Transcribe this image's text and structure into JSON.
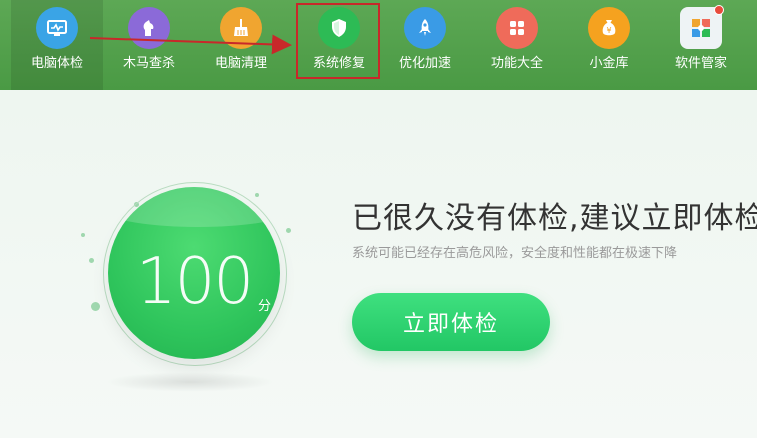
{
  "nav": {
    "items": [
      {
        "label": "电脑体检",
        "icon": "monitor-icon",
        "color": "#3aa4e6"
      },
      {
        "label": "木马查杀",
        "icon": "horse-icon",
        "color": "#8b6ad8"
      },
      {
        "label": "电脑清理",
        "icon": "broom-icon",
        "color": "#f0a530"
      },
      {
        "label": "系统修复",
        "icon": "shield-icon",
        "color": "#2dbb55"
      },
      {
        "label": "优化加速",
        "icon": "rocket-icon",
        "color": "#3a9be6"
      },
      {
        "label": "功能大全",
        "icon": "grid-icon",
        "color": "#ef6b5a"
      },
      {
        "label": "小金库",
        "icon": "money-bag-icon",
        "color": "#f5a21f"
      },
      {
        "label": "软件管家",
        "icon": "software-icon",
        "color": "#eef3f5"
      }
    ],
    "active_index": 0,
    "highlighted_index": 3
  },
  "annotation": {
    "arrow_color": "#c8282a",
    "box_color": "#c8282a"
  },
  "gauge": {
    "score": "100",
    "unit": "分"
  },
  "headline": "已很久没有体检,建议立即体检",
  "subline": "系统可能已经存在高危风险，安全度和性能都在极速下降",
  "check_button": "立即体检"
}
